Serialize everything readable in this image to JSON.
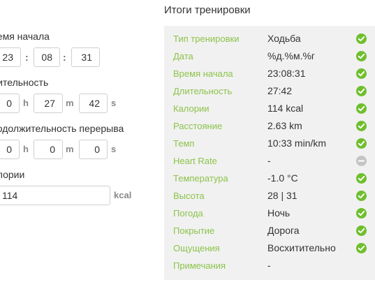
{
  "left": {
    "start_time": {
      "label": "ремя начала",
      "h": "23",
      "m": "08",
      "s": "31",
      "sep": ":"
    },
    "duration": {
      "label": "лительность",
      "h": "0",
      "m": "27",
      "s": "42",
      "unit_h": "h",
      "unit_m": "m",
      "unit_s": "s"
    },
    "break": {
      "label": "родолжительность перерыва",
      "h": "0",
      "m": "0",
      "s": "0",
      "unit_h": "h",
      "unit_m": "m",
      "unit_s": "s"
    },
    "calories": {
      "label": "алории",
      "value": "114",
      "unit": "kcal"
    }
  },
  "summary": {
    "title": "Итоги тренировки",
    "rows": [
      {
        "key": "Тип тренировки",
        "value": "Ходьба",
        "status": "ok"
      },
      {
        "key": "Дата",
        "value": "%д.%м.%г",
        "status": "ok"
      },
      {
        "key": "Время начала",
        "value": "23:08:31",
        "status": "ok"
      },
      {
        "key": "Длительность",
        "value": "27:42",
        "status": "ok"
      },
      {
        "key": "Калории",
        "value": "114 kcal",
        "status": "ok"
      },
      {
        "key": "Расстояние",
        "value": "2.63 km",
        "status": "ok"
      },
      {
        "key": "Темп",
        "value": "10:33 min/km",
        "status": "ok"
      },
      {
        "key": "Heart Rate",
        "value": "-",
        "status": "none"
      },
      {
        "key": "Температура",
        "value": "-1.0 °C",
        "status": "ok"
      },
      {
        "key": "Высота",
        "value": "28 | 31",
        "status": "ok"
      },
      {
        "key": "Погода",
        "value": "Ночь",
        "status": "ok"
      },
      {
        "key": "Покрытие",
        "value": "Дорога",
        "status": "ok"
      },
      {
        "key": "Ощущения",
        "value": "Восхитительно",
        "status": "ok"
      },
      {
        "key": "Примечания",
        "value": "-",
        "status": ""
      }
    ]
  },
  "colors": {
    "accent_green": "#8bc34a",
    "check_green": "#6fbf2d",
    "disabled_gray": "#c4c4c4",
    "panel_bg": "#f1f1f1"
  },
  "icons": {
    "ok": "check-circle-icon",
    "none": "minus-circle-icon"
  }
}
